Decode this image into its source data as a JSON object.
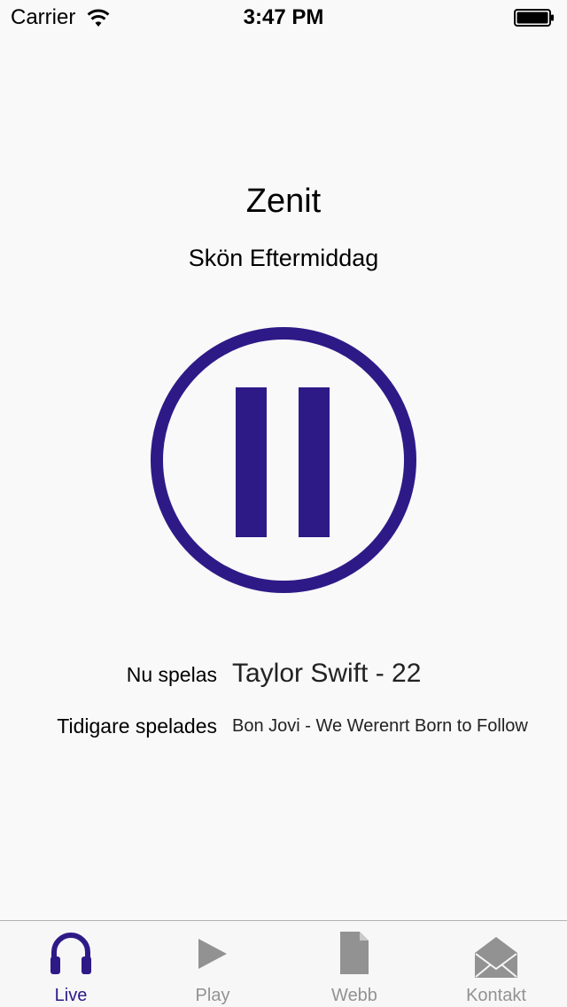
{
  "status_bar": {
    "carrier": "Carrier",
    "time": "3:47 PM"
  },
  "station": {
    "name": "Zenit",
    "show": "Skön Eftermiddag"
  },
  "player": {
    "state": "playing",
    "control_icon": "pause-icon",
    "accent_color": "#2e1a87"
  },
  "now_playing": {
    "current_label": "Nu spelas",
    "current_value": "Taylor Swift -  22",
    "previous_label": "Tidigare spelades",
    "previous_value": "Bon Jovi - We Werenrt Born to Follow"
  },
  "tab_bar": {
    "active_color": "#2e1a87",
    "inactive_color": "#929292",
    "tabs": [
      {
        "label": "Live",
        "icon": "headphones-icon",
        "active": true
      },
      {
        "label": "Play",
        "icon": "play-icon",
        "active": false
      },
      {
        "label": "Webb",
        "icon": "document-icon",
        "active": false
      },
      {
        "label": "Kontakt",
        "icon": "envelope-icon",
        "active": false
      }
    ]
  }
}
